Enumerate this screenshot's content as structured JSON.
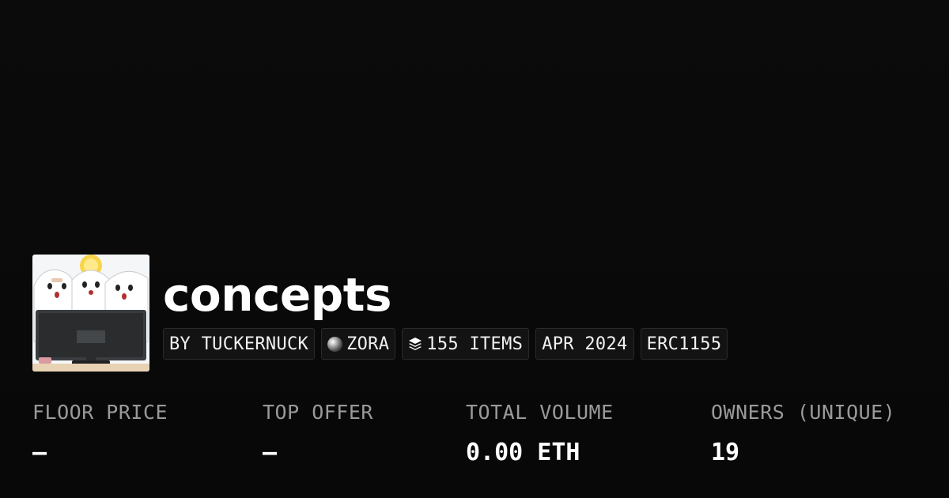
{
  "collection": {
    "name": "concepts",
    "thumbnail_icon": "ghosts-computer-artwork"
  },
  "tags": [
    {
      "label": "BY TUCKERNUCK",
      "icon": ""
    },
    {
      "label": "ZORA",
      "icon": "zora-chain-icon"
    },
    {
      "label": "155 ITEMS",
      "icon": "layers-icon"
    },
    {
      "label": "APR 2024",
      "icon": ""
    },
    {
      "label": "ERC1155",
      "icon": ""
    }
  ],
  "stats": [
    {
      "label": "FLOOR PRICE",
      "value": "–"
    },
    {
      "label": "TOP OFFER",
      "value": "–"
    },
    {
      "label": "TOTAL VOLUME",
      "value": "0.00 ETH"
    },
    {
      "label": "OWNERS (UNIQUE)",
      "value": "19"
    }
  ],
  "colors": {
    "background": "#0a0a0a",
    "text": "#ffffff",
    "muted": "#9a9a9a",
    "tag_border": "#2a2a2a"
  }
}
